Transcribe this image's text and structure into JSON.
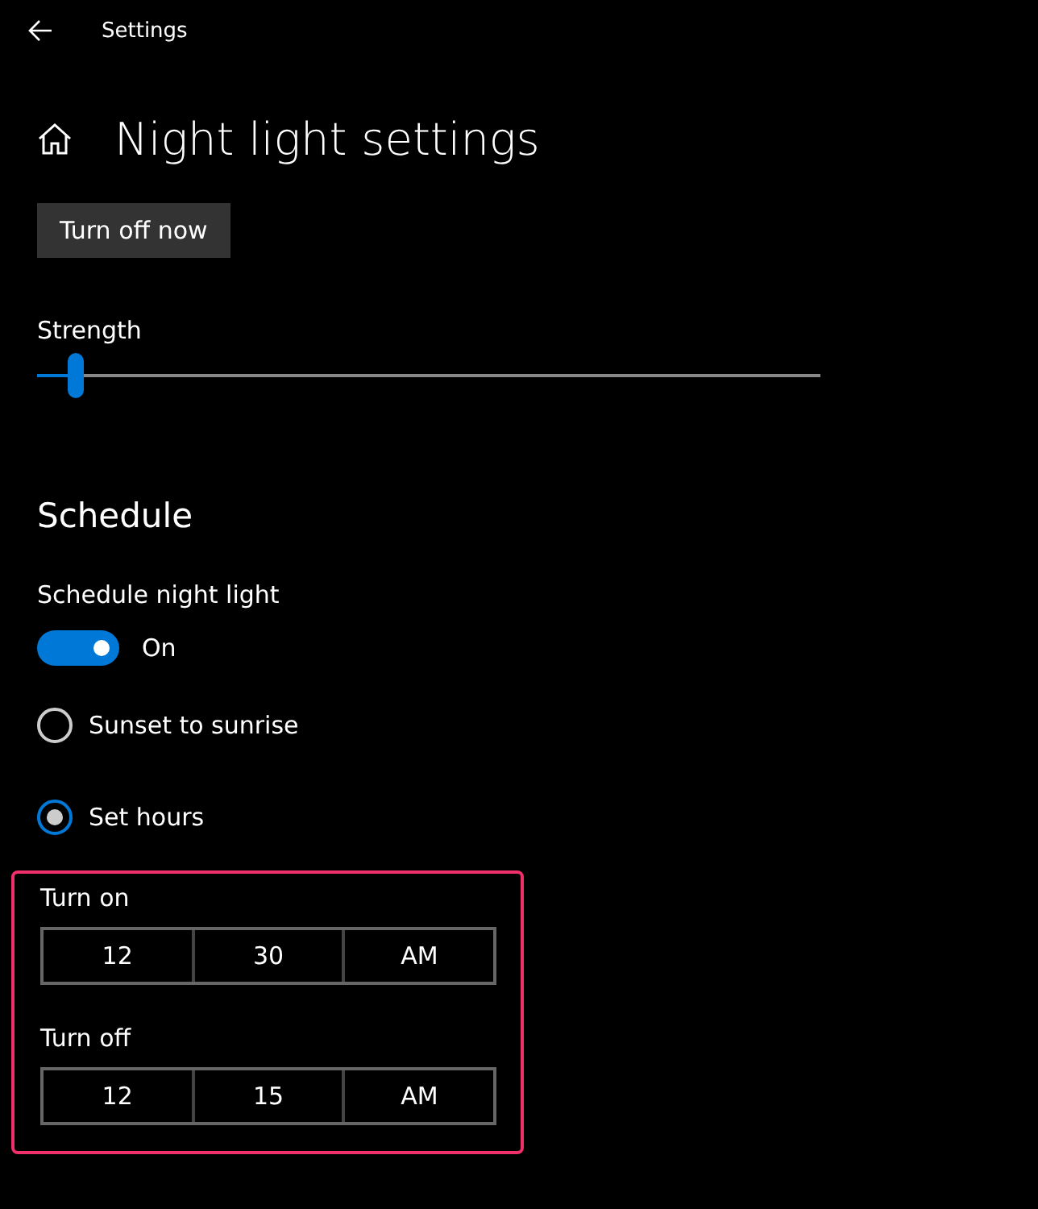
{
  "header": {
    "title": "Settings"
  },
  "page_title": "Night light settings",
  "turn_off_button": "Turn off now",
  "strength": {
    "label": "Strength",
    "level": 0.05
  },
  "schedule": {
    "heading": "Schedule",
    "label": "Schedule night light",
    "toggle": {
      "on": true,
      "state_label": "On"
    },
    "options": [
      {
        "label": "Sunset to sunrise",
        "selected": false
      },
      {
        "label": "Set hours",
        "selected": true
      }
    ],
    "highlighted": true,
    "times": [
      {
        "label": "Turn on",
        "hour": "12",
        "minute": "30",
        "period": "AM"
      },
      {
        "label": "Turn off",
        "hour": "12",
        "minute": "15",
        "period": "AM"
      }
    ]
  }
}
